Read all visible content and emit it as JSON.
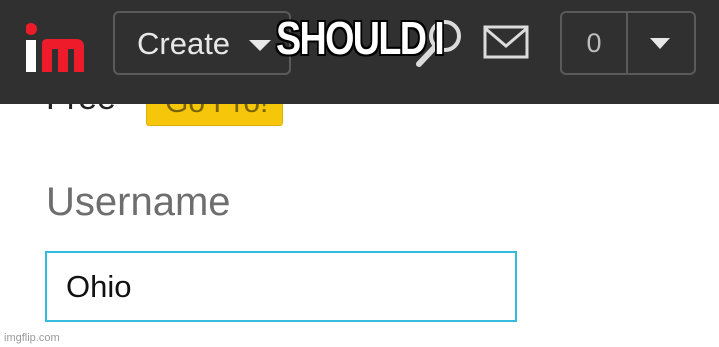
{
  "plan": {
    "label": "Free",
    "go_pro_label": "Go Pro!"
  },
  "header": {
    "logo_icon": "imgflip-logo",
    "create_label": "Create",
    "search_icon": "search-icon",
    "mail_icon": "mail-icon",
    "notification_count": "0",
    "colors": {
      "bar": "#303030",
      "accent_red": "#ee1c2a",
      "outline": "#5a5a5a"
    }
  },
  "caption": {
    "text": "SHOULD I"
  },
  "form": {
    "username_label": "Username",
    "username_value": "Ohio",
    "focus_color": "#35bcdc"
  },
  "footer": {
    "watermark": "imgflip.com"
  }
}
